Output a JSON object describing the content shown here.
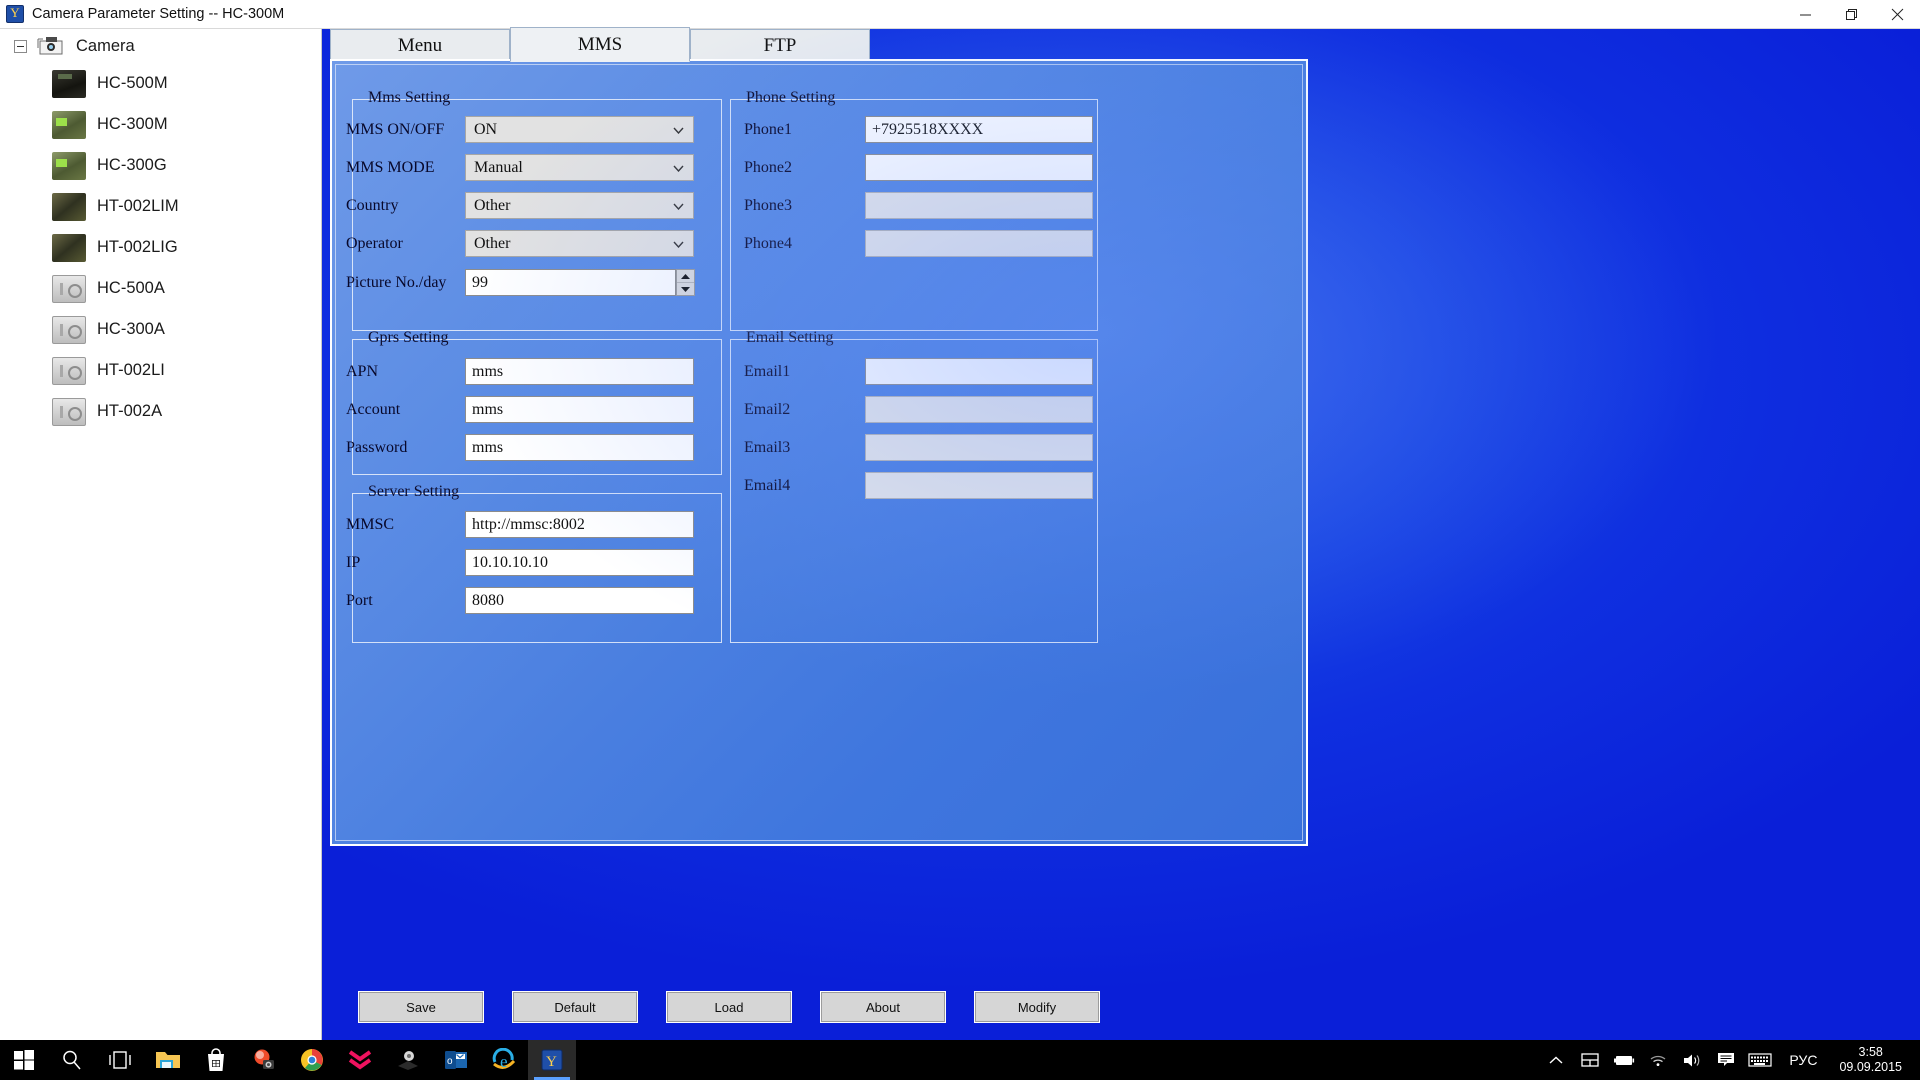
{
  "window": {
    "title": "Camera Parameter Setting -- HC-300M",
    "app_icon": "camera-app-icon",
    "minimize": "minimize-icon",
    "maximize": "restore-icon",
    "close": "close-icon"
  },
  "sidebar": {
    "root_label": "Camera",
    "items": [
      {
        "label": "HC-500M",
        "thumb": "dark"
      },
      {
        "label": "HC-300M",
        "thumb": "green"
      },
      {
        "label": "HC-300G",
        "thumb": "green"
      },
      {
        "label": "HT-002LIM",
        "thumb": "camo"
      },
      {
        "label": "HT-002LIG",
        "thumb": "camo"
      },
      {
        "label": "HC-500A",
        "thumb": "grey"
      },
      {
        "label": "HC-300A",
        "thumb": "grey"
      },
      {
        "label": "HT-002LI",
        "thumb": "grey"
      },
      {
        "label": "HT-002A",
        "thumb": "grey"
      }
    ]
  },
  "tabs": [
    {
      "label": "Menu",
      "selected": false
    },
    {
      "label": "MMS",
      "selected": true
    },
    {
      "label": "FTP",
      "selected": false
    }
  ],
  "groups": {
    "mms": {
      "title": "Mms Setting",
      "fields": [
        {
          "label": "MMS ON/OFF",
          "value": "ON",
          "type": "combo"
        },
        {
          "label": "MMS MODE",
          "value": "Manual",
          "type": "combo"
        },
        {
          "label": "Country",
          "value": "Other",
          "type": "combo"
        },
        {
          "label": "Operator",
          "value": "Other",
          "type": "combo"
        },
        {
          "label": "Picture No./day",
          "value": "99",
          "type": "spinner"
        }
      ]
    },
    "phone": {
      "title": "Phone Setting",
      "fields": [
        {
          "label": "Phone1",
          "value": "+7925518XXXX",
          "enabled": true
        },
        {
          "label": "Phone2",
          "value": "",
          "enabled": true
        },
        {
          "label": "Phone3",
          "value": "",
          "enabled": false
        },
        {
          "label": "Phone4",
          "value": "",
          "enabled": false
        }
      ]
    },
    "gprs": {
      "title": "Gprs Setting",
      "fields": [
        {
          "label": "APN",
          "value": "mms",
          "enabled": true
        },
        {
          "label": "Account",
          "value": "mms",
          "enabled": true
        },
        {
          "label": "Password",
          "value": "mms",
          "enabled": true
        }
      ]
    },
    "server": {
      "title": "Server Setting",
      "fields": [
        {
          "label": "MMSC",
          "value": "http://mmsc:8002",
          "enabled": true
        },
        {
          "label": "IP",
          "value": "10.10.10.10",
          "enabled": true
        },
        {
          "label": "Port",
          "value": "8080",
          "enabled": true
        }
      ]
    },
    "email": {
      "title": "Email Setting",
      "fields": [
        {
          "label": "Email1",
          "value": "",
          "enabled": true
        },
        {
          "label": "Email2",
          "value": "",
          "enabled": false
        },
        {
          "label": "Email3",
          "value": "",
          "enabled": false
        },
        {
          "label": "Email4",
          "value": "",
          "enabled": false
        }
      ]
    }
  },
  "buttons": [
    {
      "label": "Save"
    },
    {
      "label": "Default"
    },
    {
      "label": "Load"
    },
    {
      "label": "About"
    },
    {
      "label": "Modify"
    }
  ],
  "taskbar": {
    "items": [
      {
        "icon": "windows-start-icon",
        "active": false
      },
      {
        "icon": "search-icon",
        "active": false
      },
      {
        "icon": "task-view-icon",
        "active": false
      },
      {
        "icon": "file-explorer-icon",
        "active": false
      },
      {
        "icon": "microsoft-store-icon",
        "active": false
      },
      {
        "icon": "photo-viewer-icon",
        "active": false
      },
      {
        "icon": "google-chrome-icon",
        "active": false
      },
      {
        "icon": "chevrons-app-icon",
        "active": false
      },
      {
        "icon": "gear-app-icon",
        "active": false
      },
      {
        "icon": "outlook-icon",
        "active": false
      },
      {
        "icon": "internet-explorer-icon",
        "active": false
      },
      {
        "icon": "camera-app-icon",
        "active": true
      }
    ],
    "tray": [
      "chevron-up-icon",
      "tablet-mode-icon",
      "battery-icon",
      "wifi-icon",
      "volume-icon",
      "notifications-icon",
      "keyboard-icon"
    ],
    "language": "РУС",
    "time": "3:58",
    "date": "09.09.2015"
  },
  "colors": {
    "desktop_blue": "#0f2fe0",
    "panel_blue": "#4a7fe0",
    "accent_white": "#ffffff"
  }
}
